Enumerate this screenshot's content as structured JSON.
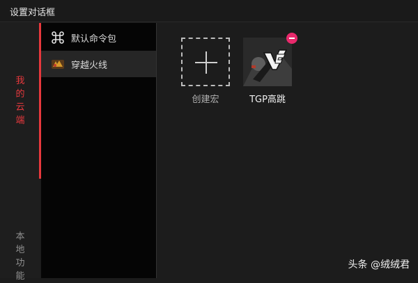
{
  "window": {
    "title": "设置对话框"
  },
  "rail": {
    "active_tab": {
      "chars": [
        "我",
        "的",
        "云",
        "端"
      ]
    },
    "inactive_tab": {
      "chars": [
        "本",
        "地",
        "功",
        "能"
      ]
    }
  },
  "menu": {
    "items": [
      {
        "label": "默认命令包",
        "icon": "command-key-icon"
      },
      {
        "label": "穿越火线",
        "icon": "crossfire-game-icon"
      }
    ],
    "selected_index": 1
  },
  "macros": {
    "create_label": "创建宏",
    "items": [
      {
        "label": "TGP高跳",
        "icon": "crossfire-logo-thumbnail"
      }
    ]
  },
  "watermark": "头条 @绒绒君",
  "colors": {
    "accent": "#e8383d",
    "badge": "#e8296b"
  }
}
